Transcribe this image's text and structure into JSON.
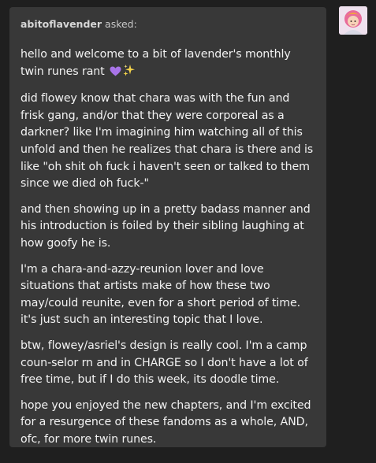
{
  "ask": {
    "asker": "abitoflavender",
    "asked_label": "asked:",
    "paragraphs": [
      "hello and welcome to a bit of lavender's monthly twin runes rant",
      "did flowey know that chara was with the fun and frisk gang, and/or that they were corporeal as a darkner? like I'm imagining him watching all of this unfold and then he realizes that chara is there and is like \"oh shit oh fuck i haven't seen or talked to them since we died oh fuck-\"",
      "and then showing up in a pretty badass manner and his introduction is foiled by their sibling laughing at how goofy he is.",
      "I'm a chara-and-azzy-reunion lover and love situations that artists make of how these two may/could reunite, even for a short period of time. it's just such an interesting topic that I love.",
      "btw, flowey/asriel's design is really cool. I'm a camp coun-selor rn and in CHARGE so I don't have a lot of free time, but if I do this week, its doodle time.",
      "hope you enjoyed the new chapters, and I'm excited for a resurgence of these fandoms as a whole, AND, ofc, for more twin runes."
    ],
    "emojis": [
      "purple-heart-icon",
      "sparkles-icon"
    ]
  },
  "colors": {
    "page_background": "#1f1f1f",
    "card_background": "#383838",
    "text": "#f2f2f2",
    "header_text": "#c9c9c9",
    "heart": "#a874e8",
    "sparkle": "#f5d34a"
  }
}
